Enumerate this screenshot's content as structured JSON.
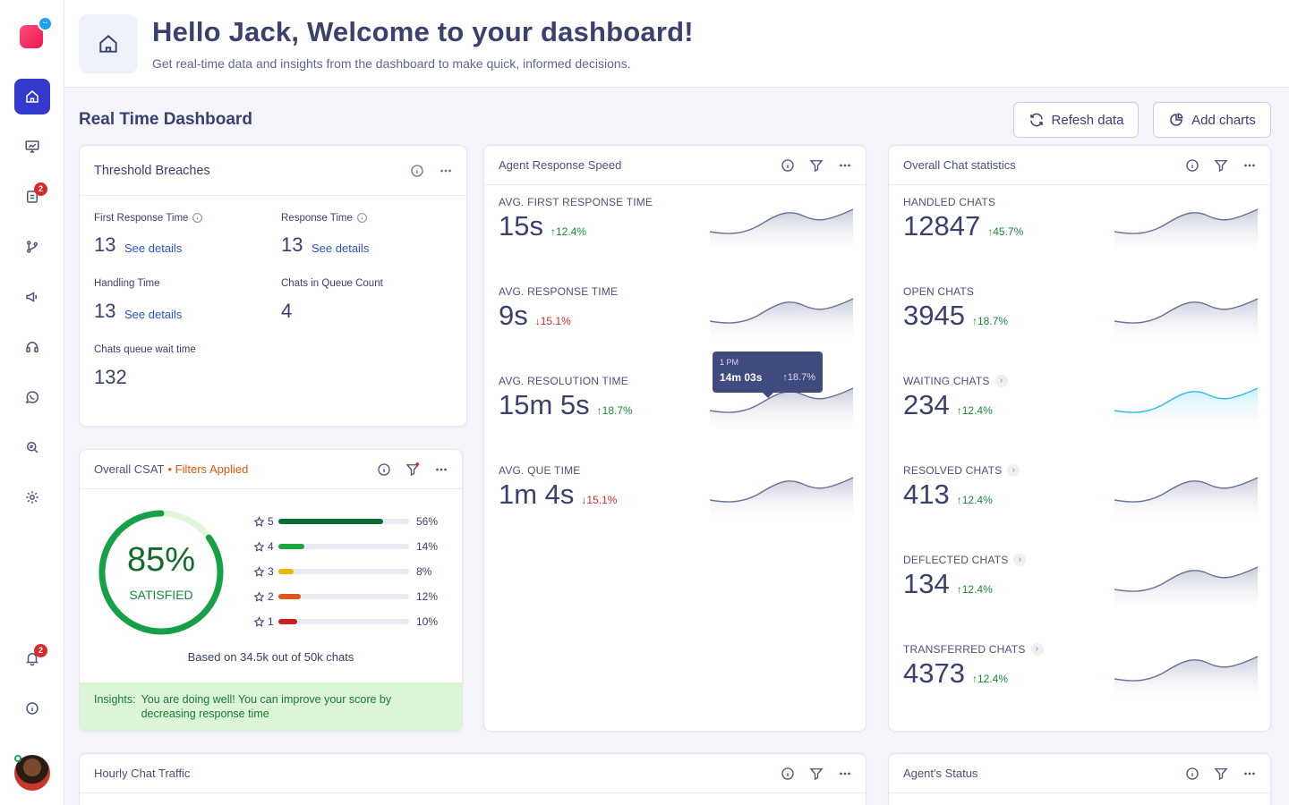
{
  "app": {
    "badges": {
      "messages": "2",
      "notifications": "2"
    }
  },
  "header": {
    "title": "Hello Jack, Welcome to your dashboard!",
    "subtitle": "Get real-time data and insights from the dashboard to make quick, informed decisions."
  },
  "toolbar": {
    "section_title": "Real Time Dashboard",
    "refresh_label": "Refesh data",
    "add_charts_label": "Add charts"
  },
  "threshold": {
    "title": "Threshold Breaches",
    "items": [
      {
        "label": "First Response Time",
        "value": "13",
        "link": "See details"
      },
      {
        "label": "Response Time",
        "value": "13",
        "link": "See details"
      },
      {
        "label": "Handling Time",
        "value": "13",
        "link": "See details"
      },
      {
        "label": "Chats in Queue Count",
        "value": "4"
      },
      {
        "label": "Chats queue wait time",
        "value": "132"
      }
    ]
  },
  "csat": {
    "title": "Overall CSAT",
    "filters": "• Filters Applied",
    "percent": "85%",
    "percent_value": 0.85,
    "status": "SATISFIED",
    "ratings": [
      {
        "stars": "5",
        "pct": "56%",
        "value": 56,
        "color": "#0e6b35"
      },
      {
        "stars": "4",
        "pct": "14%",
        "value": 14,
        "color": "#1aa53f"
      },
      {
        "stars": "3",
        "pct": "8%",
        "value": 8,
        "color": "#e8b800"
      },
      {
        "stars": "2",
        "pct": "12%",
        "value": 12,
        "color": "#e0561a"
      },
      {
        "stars": "1",
        "pct": "10%",
        "value": 10,
        "color": "#cc1f1f"
      }
    ],
    "based_on": "Based on 34.5k out of 50k chats",
    "insights_label": "Insights:",
    "insights_text": "You are doing well! You can improve your score by decreasing response time"
  },
  "agent_speed": {
    "title": "Agent Response Speed",
    "metrics": [
      {
        "label": "AVG. FIRST RESPONSE TIME",
        "value": "15s",
        "delta": "12.4%",
        "direction": "up"
      },
      {
        "label": "AVG. RESPONSE TIME",
        "value": "9s",
        "delta": "15.1%",
        "direction": "down"
      },
      {
        "label": "AVG. RESOLUTION TIME",
        "value": "15m 5s",
        "delta": "18.7%",
        "direction": "up"
      },
      {
        "label": "AVG. QUE TIME",
        "value": "1m 4s",
        "delta": "15.1%",
        "direction": "down"
      }
    ],
    "tooltip": {
      "time": "1 PM",
      "value": "14m 03s",
      "delta": "18.7%"
    }
  },
  "chat_stats": {
    "title": "Overall Chat statistics",
    "metrics": [
      {
        "label": "HANDLED CHATS",
        "value": "12847",
        "delta": "45.7%",
        "direction": "up",
        "chevron": false
      },
      {
        "label": "OPEN CHATS",
        "value": "3945",
        "delta": "18.7%",
        "direction": "up",
        "chevron": false
      },
      {
        "label": "WAITING CHATS",
        "value": "234",
        "delta": "12.4%",
        "direction": "up",
        "chevron": true
      },
      {
        "label": "RESOLVED CHATS",
        "value": "413",
        "delta": "12.4%",
        "direction": "up",
        "chevron": true
      },
      {
        "label": "DEFLECTED CHATS",
        "value": "134",
        "delta": "12.4%",
        "direction": "up",
        "chevron": true
      },
      {
        "label": "TRANSFERRED CHATS",
        "value": "4373",
        "delta": "12.4%",
        "direction": "up",
        "chevron": true
      }
    ]
  },
  "hourly": {
    "title": "Hourly Chat Traffic"
  },
  "agent_status": {
    "title": "Agent's Status"
  },
  "colors": {
    "accent": "#3538cd",
    "spark_fill": "#c7cbdc",
    "spark_line": "#6a7396",
    "spark_highlight": "#35b9e9",
    "csat_ring": "#16a047"
  }
}
